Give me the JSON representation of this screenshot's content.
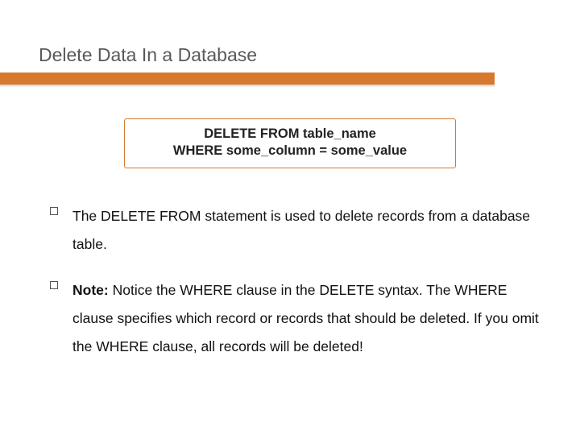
{
  "title": "Delete Data In a Database",
  "syntax": {
    "line1": "DELETE FROM table_name",
    "line2": "WHERE some_column = some_value"
  },
  "bullets": [
    {
      "text": "The DELETE FROM statement is used to delete records from a database table."
    },
    {
      "prefix_bold": "Note:",
      "text": " Notice the WHERE clause in the DELETE syntax. The WHERE clause specifies which record or records that should be deleted. If you omit the WHERE clause, all records will be deleted!"
    }
  ]
}
